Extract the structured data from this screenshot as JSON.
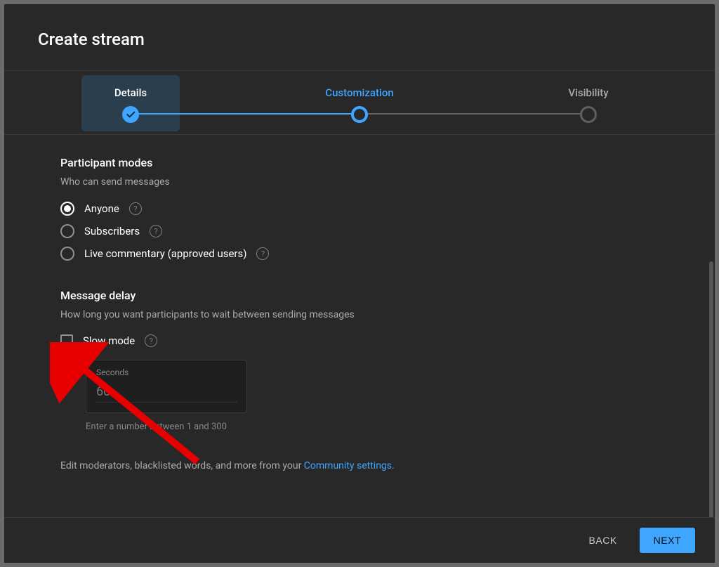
{
  "header": {
    "title": "Create stream"
  },
  "stepper": {
    "steps": [
      {
        "label": "Details"
      },
      {
        "label": "Customization"
      },
      {
        "label": "Visibility"
      }
    ]
  },
  "participant": {
    "title": "Participant modes",
    "subtitle": "Who can send messages",
    "options": [
      {
        "label": "Anyone",
        "selected": true
      },
      {
        "label": "Subscribers",
        "selected": false
      },
      {
        "label": "Live commentary (approved users)",
        "selected": false
      }
    ]
  },
  "delay": {
    "title": "Message delay",
    "subtitle": "How long you want participants to wait between sending messages",
    "slow_mode_label": "Slow mode",
    "seconds_label": "Seconds",
    "seconds_value": "60",
    "seconds_hint": "Enter a number between 1 and 300"
  },
  "moderation": {
    "prefix": "Edit moderators, blacklisted words, and more from your ",
    "link": "Community settings",
    "suffix": "."
  },
  "footer": {
    "back": "Back",
    "next": "Next"
  }
}
